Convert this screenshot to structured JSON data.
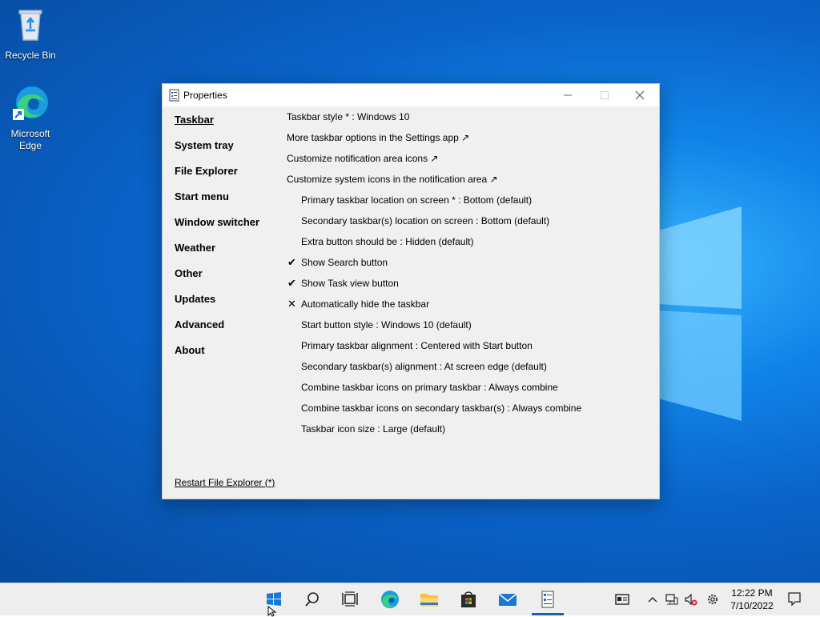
{
  "desktop": {
    "icons": [
      {
        "label": "Recycle Bin"
      },
      {
        "label": "Microsoft Edge"
      }
    ]
  },
  "window": {
    "title": "Properties",
    "nav": [
      {
        "label": "Taskbar"
      },
      {
        "label": "System tray"
      },
      {
        "label": "File Explorer"
      },
      {
        "label": "Start menu"
      },
      {
        "label": "Window switcher"
      },
      {
        "label": "Weather"
      },
      {
        "label": "Other"
      },
      {
        "label": "Updates"
      },
      {
        "label": "Advanced"
      },
      {
        "label": "About"
      }
    ],
    "options": [
      {
        "text": "Taskbar style * : Windows 10",
        "mark": ""
      },
      {
        "text": "More taskbar options in the Settings app ↗",
        "mark": ""
      },
      {
        "text": "Customize notification area icons ↗",
        "mark": ""
      },
      {
        "text": "Customize system icons in the notification area ↗",
        "mark": ""
      },
      {
        "text": "Primary taskbar location on screen * : Bottom (default)",
        "mark": ""
      },
      {
        "text": "Secondary taskbar(s) location on screen : Bottom (default)",
        "mark": ""
      },
      {
        "text": "Extra button should be : Hidden (default)",
        "mark": ""
      },
      {
        "text": "Show Search button",
        "mark": "✔"
      },
      {
        "text": "Show Task view button",
        "mark": "✔"
      },
      {
        "text": "Automatically hide the taskbar",
        "mark": "✕"
      },
      {
        "text": "Start button style : Windows 10 (default)",
        "mark": ""
      },
      {
        "text": "Primary taskbar alignment : Centered with Start button",
        "mark": ""
      },
      {
        "text": "Secondary taskbar(s) alignment : At screen edge (default)",
        "mark": ""
      },
      {
        "text": "Combine taskbar icons on primary taskbar : Always combine",
        "mark": ""
      },
      {
        "text": "Combine taskbar icons on secondary taskbar(s) : Always combine",
        "mark": ""
      },
      {
        "text": "Taskbar icon size : Large (default)",
        "mark": ""
      }
    ],
    "restart_label": "Restart File Explorer (*)"
  },
  "taskbar": {
    "apps": [
      {
        "icon": "start-icon"
      },
      {
        "icon": "search-icon"
      },
      {
        "icon": "task-view-icon"
      },
      {
        "icon": "edge-icon"
      },
      {
        "icon": "file-explorer-icon"
      },
      {
        "icon": "store-icon"
      },
      {
        "icon": "mail-icon"
      },
      {
        "icon": "properties-app-icon"
      }
    ],
    "clock": {
      "time": "12:22 PM",
      "date": "7/10/2022"
    }
  },
  "colors": {
    "accent": "#0078d7",
    "window_bg": "#f0f0f0"
  }
}
